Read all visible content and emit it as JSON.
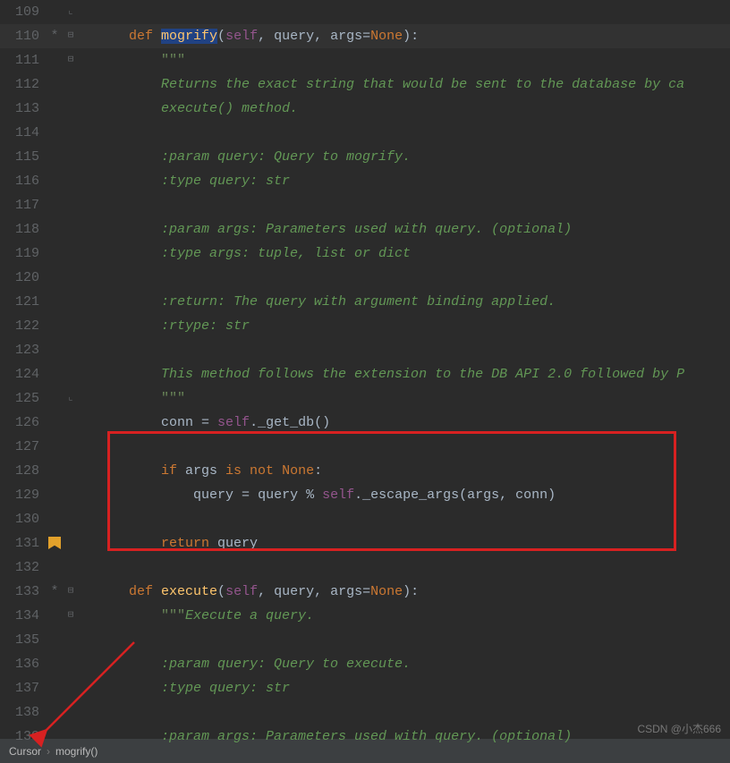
{
  "gutter": {
    "start": 109,
    "end": 139,
    "change_marker": "*",
    "bookmark_line": 131,
    "highlighted_line": 110
  },
  "code": {
    "109": {
      "indent": "",
      "tokens": []
    },
    "110": {
      "indent": "    ",
      "tokens": [
        [
          "kw",
          "def "
        ],
        [
          "sel",
          "mogrify"
        ],
        [
          "op",
          "("
        ],
        [
          "slf",
          "self"
        ],
        [
          "op",
          ", "
        ],
        [
          "prm",
          "query"
        ],
        [
          "op",
          ", "
        ],
        [
          "prm",
          "args"
        ],
        [
          "op",
          "="
        ],
        [
          "none",
          "None"
        ],
        [
          "op",
          "):"
        ]
      ]
    },
    "111": {
      "indent": "        ",
      "tokens": [
        [
          "str",
          "\"\"\""
        ]
      ]
    },
    "112": {
      "indent": "        ",
      "tokens": [
        [
          "doc",
          "Returns the exact string that would be sent to the database by ca"
        ]
      ]
    },
    "113": {
      "indent": "        ",
      "tokens": [
        [
          "doc",
          "execute() method."
        ]
      ]
    },
    "114": {
      "indent": "",
      "tokens": []
    },
    "115": {
      "indent": "        ",
      "tokens": [
        [
          "doc",
          ":param query: Query to mogrify."
        ]
      ]
    },
    "116": {
      "indent": "        ",
      "tokens": [
        [
          "doc",
          ":type query: str"
        ]
      ]
    },
    "117": {
      "indent": "",
      "tokens": []
    },
    "118": {
      "indent": "        ",
      "tokens": [
        [
          "doc",
          ":param args: Parameters used with query. (optional)"
        ]
      ]
    },
    "119": {
      "indent": "        ",
      "tokens": [
        [
          "doc",
          ":type args: tuple, list or dict"
        ]
      ]
    },
    "120": {
      "indent": "",
      "tokens": []
    },
    "121": {
      "indent": "        ",
      "tokens": [
        [
          "doc",
          ":return: The query with argument binding applied."
        ]
      ]
    },
    "122": {
      "indent": "        ",
      "tokens": [
        [
          "doc",
          ":rtype: str"
        ]
      ]
    },
    "123": {
      "indent": "",
      "tokens": []
    },
    "124": {
      "indent": "        ",
      "tokens": [
        [
          "doc",
          "This method follows the extension to the DB API 2.0 followed by P"
        ]
      ]
    },
    "125": {
      "indent": "        ",
      "tokens": [
        [
          "str",
          "\"\"\""
        ]
      ]
    },
    "126": {
      "indent": "        ",
      "tokens": [
        [
          "prm",
          "conn "
        ],
        [
          "op",
          "= "
        ],
        [
          "slf",
          "self"
        ],
        [
          "op",
          "."
        ],
        [
          "prm",
          "_get_db()"
        ]
      ]
    },
    "127": {
      "indent": "",
      "tokens": []
    },
    "128": {
      "indent": "        ",
      "tokens": [
        [
          "kw",
          "if "
        ],
        [
          "prm",
          "args "
        ],
        [
          "kw",
          "is not "
        ],
        [
          "none",
          "None"
        ],
        [
          "op",
          ":"
        ]
      ]
    },
    "129": {
      "indent": "            ",
      "tokens": [
        [
          "prm",
          "query "
        ],
        [
          "op",
          "= "
        ],
        [
          "prm",
          "query "
        ],
        [
          "op",
          "% "
        ],
        [
          "slf",
          "self"
        ],
        [
          "op",
          "."
        ],
        [
          "prm",
          "_escape_args(args"
        ],
        [
          "op",
          ", "
        ],
        [
          "prm",
          "conn)"
        ]
      ]
    },
    "130": {
      "indent": "",
      "tokens": []
    },
    "131": {
      "indent": "        ",
      "tokens": [
        [
          "kw",
          "return "
        ],
        [
          "prm",
          "query"
        ]
      ]
    },
    "132": {
      "indent": "",
      "tokens": []
    },
    "133": {
      "indent": "    ",
      "tokens": [
        [
          "kw",
          "def "
        ],
        [
          "fn",
          "execute"
        ],
        [
          "op",
          "("
        ],
        [
          "slf",
          "self"
        ],
        [
          "op",
          ", "
        ],
        [
          "prm",
          "query"
        ],
        [
          "op",
          ", "
        ],
        [
          "prm",
          "args"
        ],
        [
          "op",
          "="
        ],
        [
          "none",
          "None"
        ],
        [
          "op",
          "):"
        ]
      ]
    },
    "134": {
      "indent": "        ",
      "tokens": [
        [
          "str",
          "\"\"\""
        ],
        [
          "doc",
          "Execute a query."
        ]
      ]
    },
    "135": {
      "indent": "",
      "tokens": []
    },
    "136": {
      "indent": "        ",
      "tokens": [
        [
          "doc",
          ":param query: Query to execute."
        ]
      ]
    },
    "137": {
      "indent": "        ",
      "tokens": [
        [
          "doc",
          ":type query: str"
        ]
      ]
    },
    "138": {
      "indent": "",
      "tokens": []
    },
    "139": {
      "indent": "        ",
      "tokens": [
        [
          "doc",
          ":param args: Parameters used with query. (optional)"
        ]
      ]
    }
  },
  "fold": {
    "starts": [
      110,
      111,
      133,
      134
    ],
    "ends": [
      125,
      109
    ],
    "mark_lines": [
      110,
      133
    ]
  },
  "breadcrumb": {
    "root": "Cursor",
    "current": "mogrify()"
  },
  "watermark": "CSDN @小杰666"
}
